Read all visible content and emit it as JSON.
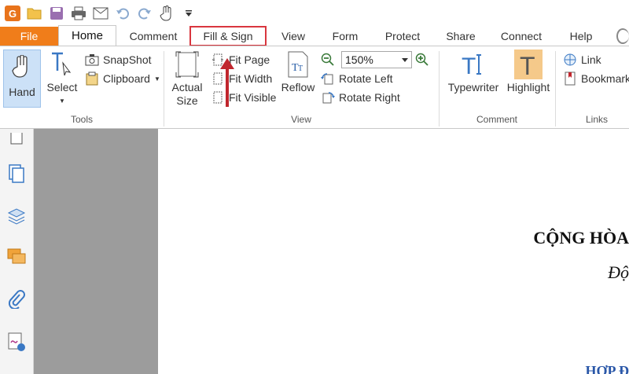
{
  "quick_access": {
    "logo_letter": "G",
    "icons": [
      "app-logo",
      "open-folder-icon",
      "save-icon",
      "print-icon",
      "email-icon",
      "undo-icon",
      "redo-icon",
      "hand-tool-icon",
      "dropdown-icon"
    ]
  },
  "tabs": [
    {
      "label": "File"
    },
    {
      "label": "Home"
    },
    {
      "label": "Comment"
    },
    {
      "label": "Fill & Sign"
    },
    {
      "label": "View"
    },
    {
      "label": "Form"
    },
    {
      "label": "Protect"
    },
    {
      "label": "Share"
    },
    {
      "label": "Connect"
    },
    {
      "label": "Help"
    }
  ],
  "ribbon": {
    "tools": {
      "hand": "Hand",
      "select": "Select",
      "snapshot": "SnapShot",
      "clipboard": "Clipboard",
      "group_label": "Tools"
    },
    "view": {
      "actual_size_line1": "Actual",
      "actual_size_line2": "Size",
      "fit_page": "Fit Page",
      "fit_width": "Fit Width",
      "fit_visible": "Fit Visible",
      "reflow": "Reflow",
      "zoom_value": "150%",
      "rotate_left": "Rotate Left",
      "rotate_right": "Rotate Right",
      "group_label": "View"
    },
    "comment": {
      "typewriter": "Typewriter",
      "highlight": "Highlight",
      "group_label": "Comment"
    },
    "links": {
      "link": "Link",
      "bookmark": "Bookmark",
      "group_label": "Links"
    }
  },
  "document": {
    "line1": "CỘNG HÒA",
    "line2": "Độ",
    "line3": "HỢP Đ"
  },
  "colors": {
    "file_tab": "#f07d1a",
    "highlight_box": "#d9363e",
    "arrow": "#c0262d",
    "hand_active": "#cce1f7",
    "doc_gray": "#9c9c9c"
  }
}
